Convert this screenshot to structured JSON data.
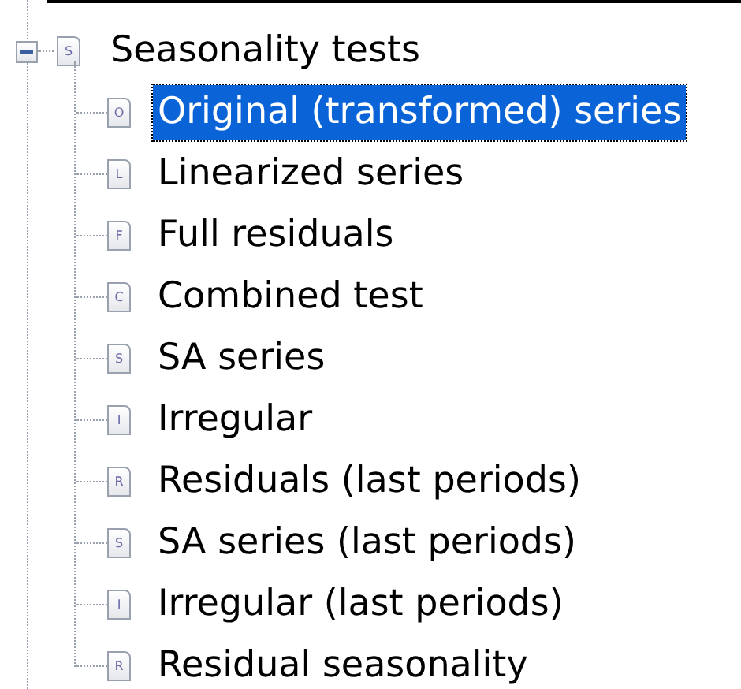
{
  "tree": {
    "label": "Seasonality tests",
    "icon_letter": "S",
    "expanded": true,
    "children": [
      {
        "label": "Original (transformed) series",
        "icon_letter": "O",
        "selected": true
      },
      {
        "label": "Linearized series",
        "icon_letter": "L",
        "selected": false
      },
      {
        "label": "Full residuals",
        "icon_letter": "F",
        "selected": false
      },
      {
        "label": "Combined test",
        "icon_letter": "C",
        "selected": false
      },
      {
        "label": "SA series",
        "icon_letter": "S",
        "selected": false
      },
      {
        "label": "Irregular",
        "icon_letter": "I",
        "selected": false
      },
      {
        "label": "Residuals (last periods)",
        "icon_letter": "R",
        "selected": false
      },
      {
        "label": "SA series (last periods)",
        "icon_letter": "S",
        "selected": false
      },
      {
        "label": "Irregular (last periods)",
        "icon_letter": "I",
        "selected": false
      },
      {
        "label": "Residual seasonality",
        "icon_letter": "R",
        "selected": false
      }
    ]
  }
}
